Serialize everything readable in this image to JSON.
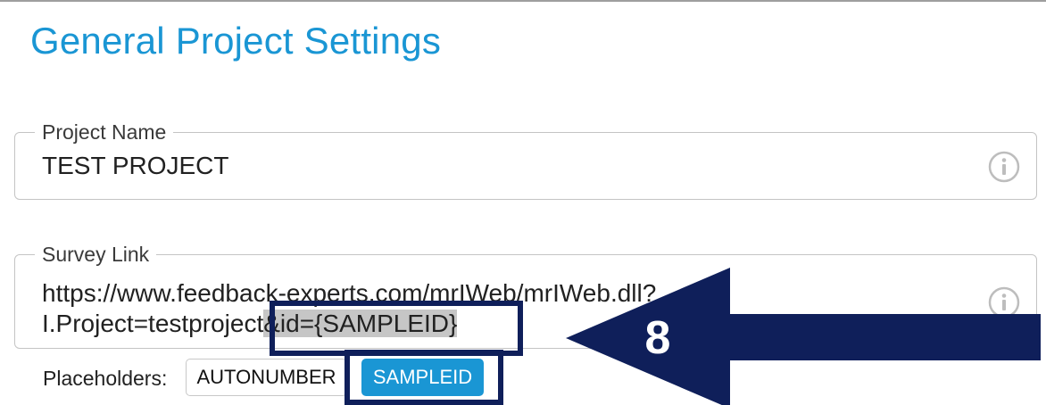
{
  "page": {
    "title": "General Project Settings"
  },
  "project_name": {
    "label": "Project Name",
    "value": "TEST PROJECT",
    "info_icon": "info-icon"
  },
  "survey_link": {
    "label": "Survey Link",
    "line1": "https://www.feedback-experts.com/mrIWeb/mrIWeb.dll?",
    "line2_prefix": "I.Project=testproject",
    "line2_highlight": "&id={SAMPLEID}",
    "info_icon": "info-icon"
  },
  "placeholders": {
    "label": "Placeholders:",
    "buttons": [
      "AUTONUMBER",
      "SAMPLEID"
    ]
  },
  "annotation": {
    "step_number": "8",
    "color": "#0f1f5a"
  },
  "colors": {
    "accent": "#1a96d4"
  }
}
